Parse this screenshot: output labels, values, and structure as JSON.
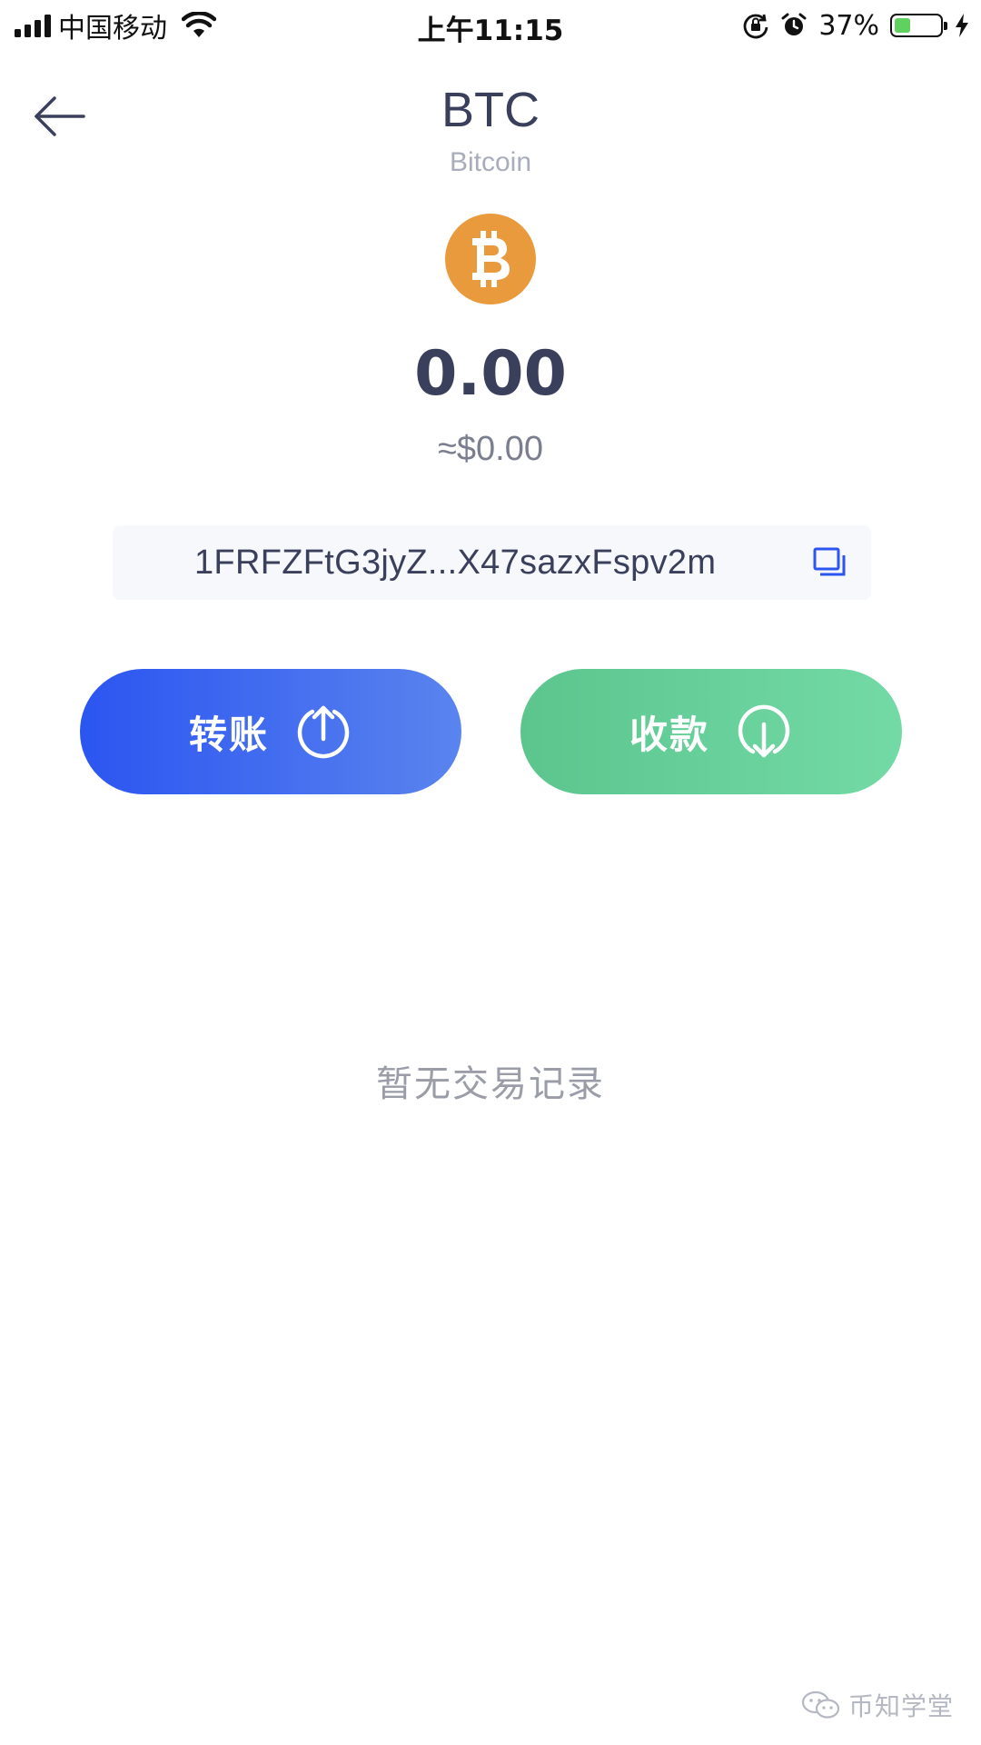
{
  "status_bar": {
    "carrier": "中国移动",
    "time": "上午11:15",
    "battery_percent": "37%",
    "battery_level": 0.37
  },
  "header": {
    "symbol": "BTC",
    "name": "Bitcoin"
  },
  "wallet": {
    "balance": "0.00",
    "fiat_value": "≈$0.00",
    "address": "1FRFZFtG3jyZ...X47sazxFspv2m"
  },
  "actions": {
    "transfer_label": "转账",
    "receive_label": "收款"
  },
  "transactions": {
    "empty_text": "暂无交易记录"
  },
  "watermark": {
    "text": "币知学堂"
  },
  "colors": {
    "coin": "#e89a3c",
    "transfer_start": "#2b55f0",
    "transfer_end": "#5a84ee",
    "receive_start": "#5cc58e",
    "receive_end": "#73daa6",
    "accent": "#2b55f0"
  },
  "icons": {
    "back": "arrow-left-icon",
    "copy": "copy-icon",
    "transfer": "upload-circle-icon",
    "receive": "download-circle-icon",
    "coin": "bitcoin-icon"
  }
}
